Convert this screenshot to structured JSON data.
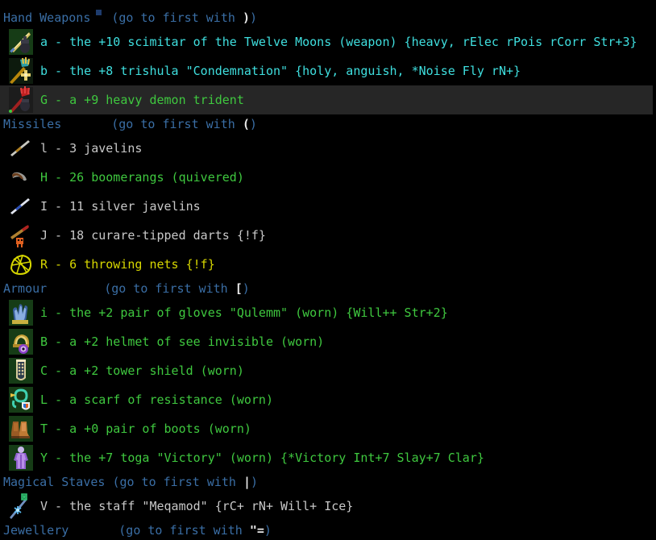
{
  "app": {
    "title": "Dungeon Crawl Stone Soup - Inventory",
    "background_color": "#000000",
    "highlight_color": "#262626",
    "header_color": "#3a6ea5",
    "key_color": "#e8e8e8"
  },
  "hint_text": "(go to first with ",
  "hint_close": ")",
  "sections": [
    {
      "name": "Hand Weapons",
      "hint": "(go to first with ",
      "key": ")",
      "hint_close": ")",
      "items": [
        {
          "letter": "a",
          "text": "a - the +10 scimitar of the Twelve Moons (weapon) {heavy, rElec rPois rCorr Str+3}",
          "color": "#3fdfdf",
          "icon": "scimitar-icon",
          "highlighted": false
        },
        {
          "letter": "b",
          "text": "b - the +8 trishula \"Condemnation\" {holy, anguish, *Noise Fly rN+}",
          "color": "#3fdfdf",
          "icon": "trishula-icon",
          "highlighted": false
        },
        {
          "letter": "G",
          "text": "G - a +9 heavy demon trident",
          "color": "#3fc83f",
          "icon": "demon-trident-icon",
          "highlighted": true
        }
      ]
    },
    {
      "name": "Missiles",
      "hint": "(go to first with ",
      "key": "(",
      "hint_close": ")",
      "items": [
        {
          "letter": "l",
          "text": "l - 3 javelins",
          "color": "#c8c8c8",
          "icon": "javelin-icon",
          "highlighted": false
        },
        {
          "letter": "H",
          "text": "H - 26 boomerangs (quivered)",
          "color": "#3fc83f",
          "icon": "boomerang-icon",
          "highlighted": false
        },
        {
          "letter": "I",
          "text": "I - 11 silver javelins",
          "color": "#c8c8c8",
          "icon": "silver-javelin-icon",
          "highlighted": false
        },
        {
          "letter": "J",
          "text": "J - 18 curare-tipped darts {!f}",
          "color": "#c8c8c8",
          "icon": "curare-dart-icon",
          "highlighted": false
        },
        {
          "letter": "R",
          "text": "R - 6 throwing nets {!f}",
          "color": "#d7d700",
          "icon": "throwing-net-icon",
          "highlighted": false
        }
      ]
    },
    {
      "name": "Armour",
      "hint": "(go to first with ",
      "key": "[",
      "hint_close": ")",
      "items": [
        {
          "letter": "i",
          "text": "i - the +2 pair of gloves \"Qulemm\" (worn) {Will++ Str+2}",
          "color": "#3fc83f",
          "icon": "gloves-icon",
          "highlighted": false
        },
        {
          "letter": "B",
          "text": "B - a +2 helmet of see invisible (worn)",
          "color": "#3fc83f",
          "icon": "helmet-icon",
          "highlighted": false
        },
        {
          "letter": "C",
          "text": "C - a +2 tower shield (worn)",
          "color": "#3fc83f",
          "icon": "tower-shield-icon",
          "highlighted": false
        },
        {
          "letter": "L",
          "text": "L - a scarf of resistance (worn)",
          "color": "#3fc83f",
          "icon": "scarf-icon",
          "highlighted": false
        },
        {
          "letter": "T",
          "text": "T - a +0 pair of boots (worn)",
          "color": "#3fc83f",
          "icon": "boots-icon",
          "highlighted": false
        },
        {
          "letter": "Y",
          "text": "Y - the +7 toga \"Victory\" (worn) {*Victory Int+7 Slay+7 Clar}",
          "color": "#3fc83f",
          "icon": "toga-icon",
          "highlighted": false
        }
      ]
    },
    {
      "name": "Magical Staves",
      "hint": "(go to first with ",
      "key": "|",
      "hint_close": ")",
      "items": [
        {
          "letter": "V",
          "text": "V - the staff \"Meqamod\" {rC+ rN+ Will+ Ice}",
          "color": "#c8c8c8",
          "icon": "staff-icon",
          "highlighted": false
        }
      ]
    },
    {
      "name": "Jewellery",
      "hint": "(go to first with ",
      "key": "\"=",
      "hint_close": ")",
      "items": []
    }
  ]
}
